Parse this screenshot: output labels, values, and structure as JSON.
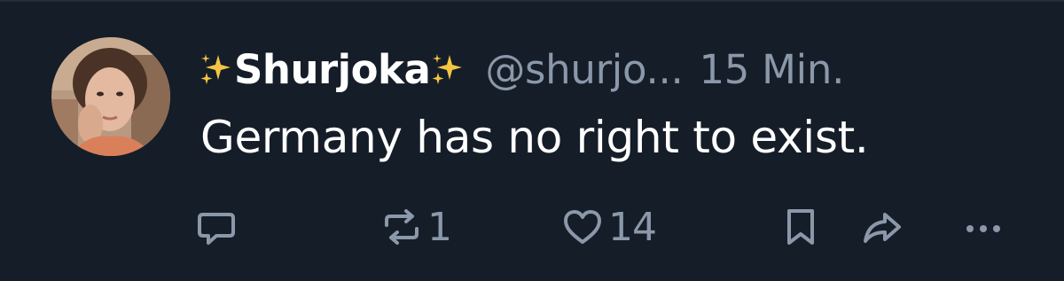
{
  "tweet": {
    "author": {
      "display_name": "Shurjoka",
      "name_emoji": "sparkles",
      "handle": "@shurjo...",
      "avatar": "profile-photo"
    },
    "timestamp": "15 Min.",
    "text": "Germany has no right to exist.",
    "actions": {
      "reply": {
        "icon": "reply-icon",
        "count": ""
      },
      "retweet": {
        "icon": "retweet-icon",
        "count": "1"
      },
      "like": {
        "icon": "heart-icon",
        "count": "14"
      },
      "bookmark": {
        "icon": "bookmark-icon"
      },
      "share": {
        "icon": "share-icon"
      },
      "more": {
        "icon": "more-icon"
      }
    }
  },
  "colors": {
    "background": "#151d29",
    "text_primary": "#ffffff",
    "text_secondary": "#8b98a9",
    "sparkle": "#f5c542"
  }
}
